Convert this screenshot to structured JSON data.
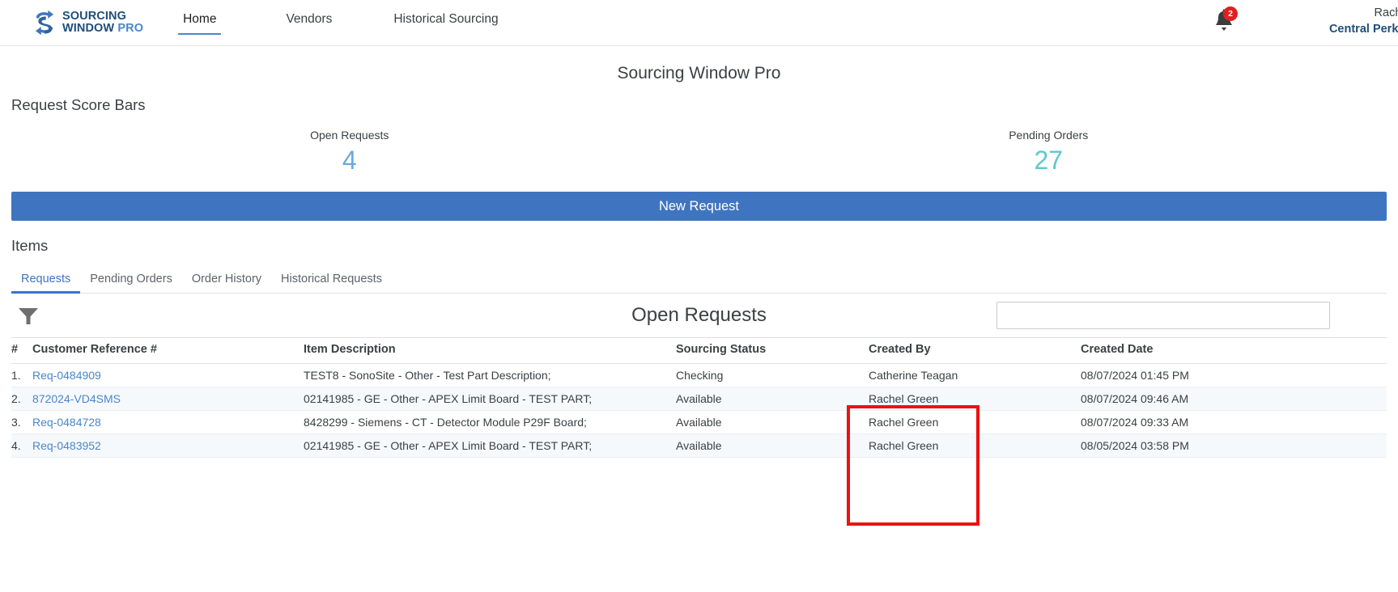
{
  "topnav": {
    "brand": {
      "line1": "SOURCING",
      "line2_a": "WINDOW ",
      "line2_b": "PRO",
      "logo_icon": "sourcing-s-arrows-logo"
    },
    "links": [
      {
        "label": "Home",
        "active": true
      },
      {
        "label": "Vendors",
        "active": false
      },
      {
        "label": "Historical Sourcing",
        "active": false
      }
    ],
    "notifications": {
      "icon": "bell-icon",
      "count": "2"
    },
    "user": {
      "name": "Rachel Green",
      "org": "Central Perk Imaging"
    }
  },
  "page": {
    "title": "Sourcing Window Pro"
  },
  "score_section": {
    "label": "Request Score Bars",
    "cards": [
      {
        "title": "Open Requests",
        "value": "4",
        "color": "#6aa8dc"
      },
      {
        "title": "Pending Orders",
        "value": "27",
        "color": "#5ec8cb"
      }
    ]
  },
  "new_request_button": {
    "label": "New Request",
    "color": "#3f75c0"
  },
  "items_section": {
    "label": "Items",
    "tabs": [
      {
        "label": "Requests",
        "active": true
      },
      {
        "label": "Pending Orders",
        "active": false
      },
      {
        "label": "Order History",
        "active": false
      },
      {
        "label": "Historical Requests",
        "active": false
      }
    ]
  },
  "table_toolbar": {
    "filter_icon": "filter-funnel-icon",
    "heading": "Open Requests",
    "search": {
      "value": "",
      "placeholder": ""
    }
  },
  "table": {
    "columns": [
      "#",
      "Customer Reference #",
      "Item Description",
      "Sourcing Status",
      "Created By",
      "Created Date"
    ],
    "rows": [
      {
        "num": "1.",
        "reference": "Req-0484909",
        "description": "TEST8 - SonoSite - Other - Test Part Description;",
        "status": "Checking",
        "created_by": "Catherine Teagan",
        "created_date": "08/07/2024 01:45 PM"
      },
      {
        "num": "2.",
        "reference": "872024-VD4SMS",
        "description": "02141985 - GE - Other - APEX Limit Board - TEST PART;",
        "status": "Available",
        "created_by": "Rachel Green",
        "created_date": "08/07/2024 09:46 AM"
      },
      {
        "num": "3.",
        "reference": "Req-0484728",
        "description": "8428299 - Siemens - CT - Detector Module P29F Board;",
        "status": "Available",
        "created_by": "Rachel Green",
        "created_date": "08/07/2024 09:33 AM"
      },
      {
        "num": "4.",
        "reference": "Req-0483952",
        "description": "02141985 - GE - Other - APEX Limit Board - TEST PART;",
        "status": "Available",
        "created_by": "Rachel Green",
        "created_date": "08/05/2024 03:58 PM"
      }
    ]
  },
  "annotation": {
    "name": "created-by-column-highlight",
    "color": "#ee1111"
  }
}
